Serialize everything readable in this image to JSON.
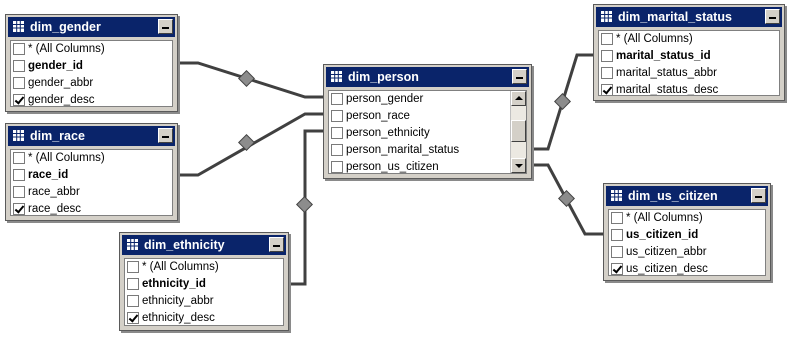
{
  "tables": {
    "dim_gender": {
      "title": "dim_gender",
      "rows": [
        {
          "label": "* (All Columns)",
          "checked": false
        },
        {
          "label": "gender_id",
          "checked": false
        },
        {
          "label": "gender_abbr",
          "checked": false
        },
        {
          "label": "gender_desc",
          "checked": true
        }
      ]
    },
    "dim_race": {
      "title": "dim_race",
      "rows": [
        {
          "label": "* (All Columns)",
          "checked": false
        },
        {
          "label": "race_id",
          "checked": false
        },
        {
          "label": "race_abbr",
          "checked": false
        },
        {
          "label": "race_desc",
          "checked": true
        }
      ]
    },
    "dim_ethnicity": {
      "title": "dim_ethnicity",
      "rows": [
        {
          "label": "* (All Columns)",
          "checked": false
        },
        {
          "label": "ethnicity_id",
          "checked": false
        },
        {
          "label": "ethnicity_abbr",
          "checked": false
        },
        {
          "label": "ethnicity_desc",
          "checked": true
        }
      ]
    },
    "dim_person": {
      "title": "dim_person",
      "rows": [
        {
          "label": "person_gender",
          "checked": false
        },
        {
          "label": "person_race",
          "checked": false
        },
        {
          "label": "person_ethnicity",
          "checked": false
        },
        {
          "label": "person_marital_status",
          "checked": false
        },
        {
          "label": "person_us_citizen",
          "checked": false
        }
      ]
    },
    "dim_marital_status": {
      "title": "dim_marital_status",
      "rows": [
        {
          "label": "* (All Columns)",
          "checked": false
        },
        {
          "label": "marital_status_id",
          "checked": false
        },
        {
          "label": "marital_status_abbr",
          "checked": false
        },
        {
          "label": "marital_status_desc",
          "checked": true
        }
      ]
    },
    "dim_us_citizen": {
      "title": "dim_us_citizen",
      "rows": [
        {
          "label": "* (All Columns)",
          "checked": false
        },
        {
          "label": "us_citizen_id",
          "checked": false
        },
        {
          "label": "us_citizen_abbr",
          "checked": false
        },
        {
          "label": "us_citizen_desc",
          "checked": true
        }
      ]
    }
  },
  "colors": {
    "title_bar": "#0a246a",
    "title_text": "#ffffff",
    "frame": "#d4d0c8",
    "link": "#404040",
    "diamond": "#8c8c8c"
  },
  "icons": {
    "title": "table-grid-icon",
    "minimize": "minimize-icon",
    "checkbox": "checkbox-icon",
    "link_marker": "relationship-diamond-icon"
  }
}
